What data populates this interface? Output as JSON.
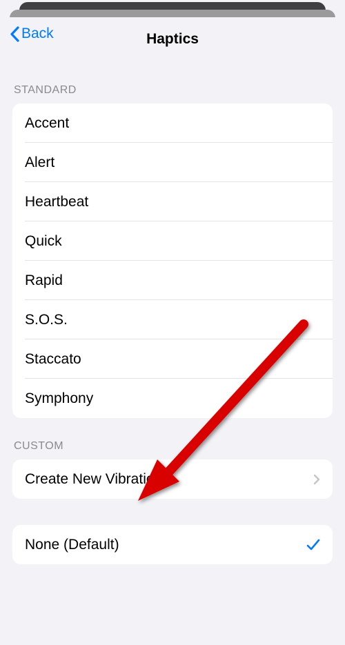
{
  "nav": {
    "back_label": "Back",
    "title": "Haptics"
  },
  "sections": {
    "standard": {
      "header": "Standard",
      "items": [
        {
          "label": "Accent"
        },
        {
          "label": "Alert"
        },
        {
          "label": "Heartbeat"
        },
        {
          "label": "Quick"
        },
        {
          "label": "Rapid"
        },
        {
          "label": "S.O.S."
        },
        {
          "label": "Staccato"
        },
        {
          "label": "Symphony"
        }
      ]
    },
    "custom": {
      "header": "Custom",
      "create_label": "Create New Vibration"
    },
    "none": {
      "label": "None (Default)",
      "selected": true
    }
  }
}
